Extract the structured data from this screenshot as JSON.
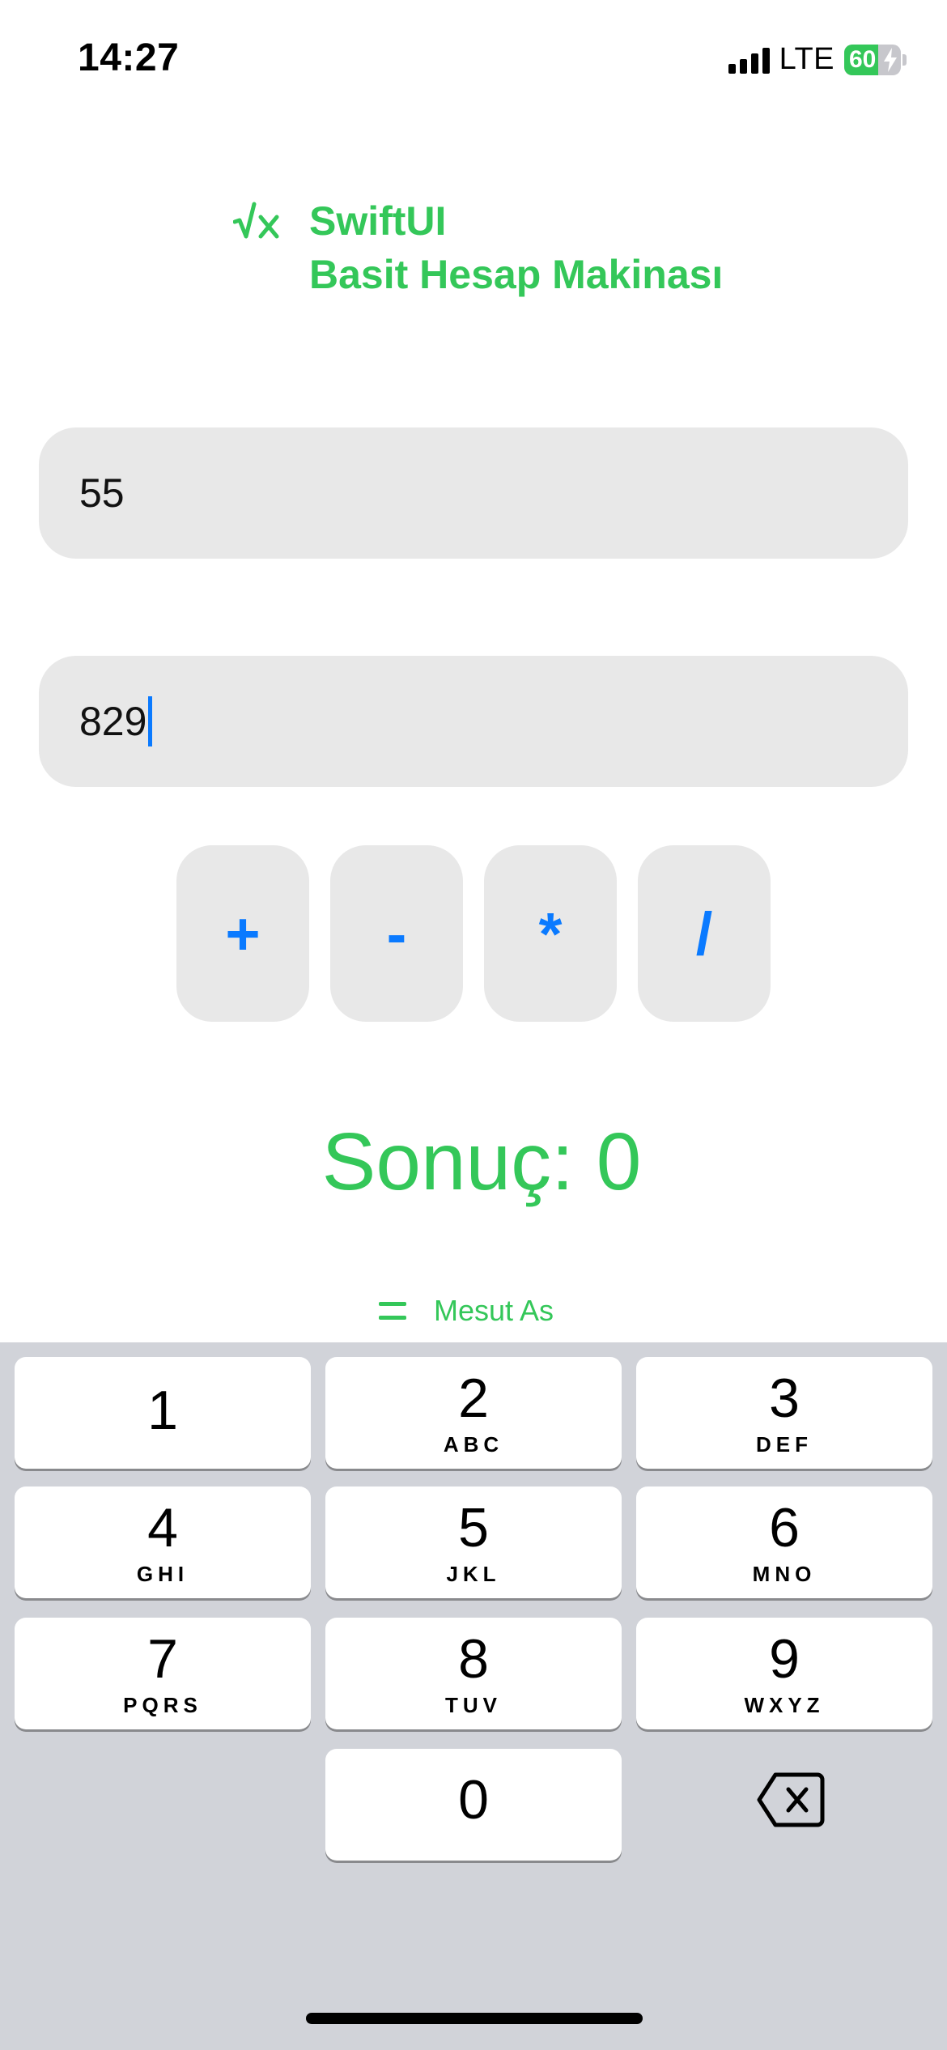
{
  "status_bar": {
    "time": "14:27",
    "network": "LTE",
    "battery": "60",
    "battery_percent": 60,
    "icons": [
      "signal-icon",
      "battery-icon",
      "charging-bolt-icon"
    ]
  },
  "header": {
    "icon": "square-root-icon",
    "title_line1": "SwiftUI",
    "title_line2": "Basit Hesap Makinası"
  },
  "inputs": {
    "first_value": "55",
    "second_value": "829"
  },
  "operators": [
    "+",
    "-",
    "*",
    "/"
  ],
  "result_text": "Sonuç: 0",
  "footer": {
    "icon": "equals-icon",
    "author": "Mesut As"
  },
  "keyboard": {
    "keys": [
      {
        "num": "1",
        "letters": ""
      },
      {
        "num": "2",
        "letters": "ABC"
      },
      {
        "num": "3",
        "letters": "DEF"
      },
      {
        "num": "4",
        "letters": "GHI"
      },
      {
        "num": "5",
        "letters": "JKL"
      },
      {
        "num": "6",
        "letters": "MNO"
      },
      {
        "num": "7",
        "letters": "PQRS"
      },
      {
        "num": "8",
        "letters": "TUV"
      },
      {
        "num": "9",
        "letters": "WXYZ"
      },
      {
        "num": "0",
        "letters": ""
      }
    ],
    "delete_icon": "delete-backspace-icon"
  },
  "colors": {
    "accent_green": "#34c759",
    "accent_blue": "#0a7aff",
    "field_bg": "#e8e8e8",
    "keyboard_bg": "#d1d3d9"
  }
}
